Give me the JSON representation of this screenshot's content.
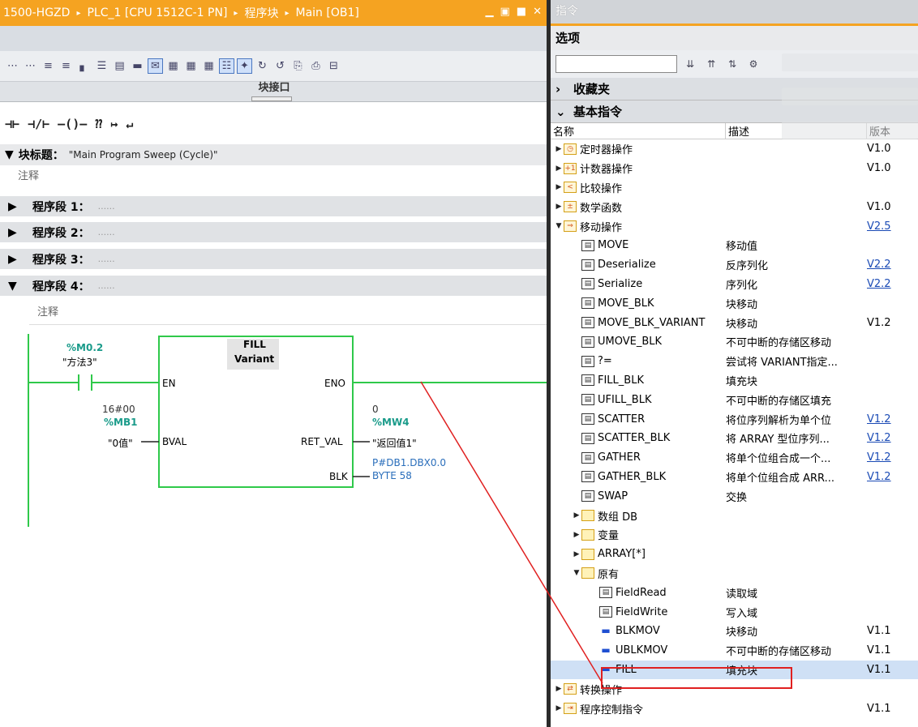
{
  "left": {
    "titlebar": {
      "crumbs": [
        "1500-HGZD",
        "PLC_1 [CPU 1512C-1 PN]",
        "程序块",
        "Main [OB1]"
      ],
      "sep": "▸"
    },
    "interface_bar": "块接口",
    "ladder_buttons": [
      "⊣⊢",
      "⊣/⊢",
      "–()–",
      "⁇",
      "↦",
      "↵"
    ],
    "block_title_label": "块标题：",
    "block_title_value": "\"Main Program Sweep (Cycle)\"",
    "comment": "注释",
    "networks": [
      {
        "label": "程序段 1：",
        "dots": "......",
        "expanded": false
      },
      {
        "label": "程序段 2：",
        "dots": "......",
        "expanded": false
      },
      {
        "label": "程序段 3：",
        "dots": "......",
        "expanded": false
      },
      {
        "label": "程序段 4：",
        "dots": "......",
        "expanded": true
      }
    ],
    "network4_comment": "注释",
    "contact": {
      "address": "%M0.2",
      "name": "\"方法3\""
    },
    "fill_block": {
      "title": "FILL",
      "type": "Variant",
      "pin_en": "EN",
      "pin_eno": "ENO",
      "pin_bval": "BVAL",
      "pin_retval": "RET_VAL",
      "pin_blk": "BLK",
      "bval_value": "16#00",
      "bval_address": "%MB1",
      "bval_name": "\"0值\"",
      "retval_value": "0",
      "retval_address": "%MW4",
      "retval_name": "\"返回值1\"",
      "blk_line1": "P#DB1.DBX0.0",
      "blk_line2": "BYTE 58"
    }
  },
  "right": {
    "title": "指令",
    "options": "选项",
    "favorites": "收藏夹",
    "basic": "基本指令",
    "columns": [
      "名称",
      "描述",
      "版本"
    ],
    "rows": [
      {
        "indent": 0,
        "exp": "▶",
        "icon": "timer-icon",
        "glyph": "◷",
        "name": "定时器操作",
        "desc": "",
        "ver": "V1.0",
        "link": false,
        "hl": false
      },
      {
        "indent": 0,
        "exp": "▶",
        "icon": "counter-icon",
        "glyph": "+1",
        "name": "计数器操作",
        "desc": "",
        "ver": "V1.0",
        "link": false,
        "hl": false
      },
      {
        "indent": 0,
        "exp": "▶",
        "icon": "compare-icon",
        "glyph": "<",
        "name": "比较操作",
        "desc": "",
        "ver": "",
        "link": false,
        "hl": false
      },
      {
        "indent": 0,
        "exp": "▶",
        "icon": "math-icon",
        "glyph": "±",
        "name": "数学函数",
        "desc": "",
        "ver": "V1.0",
        "link": false,
        "hl": false
      },
      {
        "indent": 0,
        "exp": "▼",
        "icon": "move-icon",
        "glyph": "⇒",
        "name": "移动操作",
        "desc": "",
        "ver": "V2.5",
        "link": true,
        "hl": false
      },
      {
        "indent": 1,
        "exp": "",
        "icon": "instruction-icon",
        "glyph": "▤",
        "name": "MOVE",
        "desc": "移动值",
        "ver": "",
        "link": false,
        "hl": false
      },
      {
        "indent": 1,
        "exp": "",
        "icon": "instruction-icon",
        "glyph": "▤",
        "name": "Deserialize",
        "desc": "反序列化",
        "ver": "V2.2",
        "link": true,
        "hl": false
      },
      {
        "indent": 1,
        "exp": "",
        "icon": "instruction-icon",
        "glyph": "▤",
        "name": "Serialize",
        "desc": "序列化",
        "ver": "V2.2",
        "link": true,
        "hl": false
      },
      {
        "indent": 1,
        "exp": "",
        "icon": "instruction-icon",
        "glyph": "▤",
        "name": "MOVE_BLK",
        "desc": "块移动",
        "ver": "",
        "link": false,
        "hl": false
      },
      {
        "indent": 1,
        "exp": "",
        "icon": "instruction-icon",
        "glyph": "▤",
        "name": "MOVE_BLK_VARIANT",
        "desc": "块移动",
        "ver": "V1.2",
        "link": false,
        "hl": false
      },
      {
        "indent": 1,
        "exp": "",
        "icon": "instruction-icon",
        "glyph": "▤",
        "name": "UMOVE_BLK",
        "desc": "不可中断的存储区移动",
        "ver": "",
        "link": false,
        "hl": false
      },
      {
        "indent": 1,
        "exp": "",
        "icon": "instruction-icon",
        "glyph": "▤",
        "name": "?=",
        "desc": "尝试将 VARIANT指定...",
        "ver": "",
        "link": false,
        "hl": false
      },
      {
        "indent": 1,
        "exp": "",
        "icon": "instruction-icon",
        "glyph": "▤",
        "name": "FILL_BLK",
        "desc": "填充块",
        "ver": "",
        "link": false,
        "hl": false
      },
      {
        "indent": 1,
        "exp": "",
        "icon": "instruction-icon",
        "glyph": "▤",
        "name": "UFILL_BLK",
        "desc": "不可中断的存储区填充",
        "ver": "",
        "link": false,
        "hl": false
      },
      {
        "indent": 1,
        "exp": "",
        "icon": "instruction-icon",
        "glyph": "▤",
        "name": "SCATTER",
        "desc": "将位序列解析为单个位",
        "ver": "V1.2",
        "link": true,
        "hl": false
      },
      {
        "indent": 1,
        "exp": "",
        "icon": "instruction-icon",
        "glyph": "▤",
        "name": "SCATTER_BLK",
        "desc": "将 ARRAY 型位序列...",
        "ver": "V1.2",
        "link": true,
        "hl": false
      },
      {
        "indent": 1,
        "exp": "",
        "icon": "instruction-icon",
        "glyph": "▤",
        "name": "GATHER",
        "desc": "将单个位组合成一个...",
        "ver": "V1.2",
        "link": true,
        "hl": false
      },
      {
        "indent": 1,
        "exp": "",
        "icon": "instruction-icon",
        "glyph": "▤",
        "name": "GATHER_BLK",
        "desc": "将单个位组合成 ARR...",
        "ver": "V1.2",
        "link": true,
        "hl": false
      },
      {
        "indent": 1,
        "exp": "",
        "icon": "instruction-icon",
        "glyph": "▤",
        "name": "SWAP",
        "desc": "交换",
        "ver": "",
        "link": false,
        "hl": false
      },
      {
        "indent": 1,
        "exp": "▶",
        "icon": "folder-icon",
        "glyph": "",
        "name": "数组 DB",
        "desc": "",
        "ver": "",
        "link": false,
        "hl": false
      },
      {
        "indent": 1,
        "exp": "▶",
        "icon": "folder-icon",
        "glyph": "",
        "name": "变量",
        "desc": "",
        "ver": "",
        "link": false,
        "hl": false
      },
      {
        "indent": 1,
        "exp": "▶",
        "icon": "folder-icon",
        "glyph": "",
        "name": "ARRAY[*]",
        "desc": "",
        "ver": "",
        "link": false,
        "hl": false
      },
      {
        "indent": 1,
        "exp": "▼",
        "icon": "folder-icon",
        "glyph": "",
        "name": "原有",
        "desc": "",
        "ver": "",
        "link": false,
        "hl": false
      },
      {
        "indent": 2,
        "exp": "",
        "icon": "instruction-icon",
        "glyph": "▤",
        "name": "FieldRead",
        "desc": "读取域",
        "ver": "",
        "link": false,
        "hl": false
      },
      {
        "indent": 2,
        "exp": "",
        "icon": "instruction-icon",
        "glyph": "▤",
        "name": "FieldWrite",
        "desc": "写入域",
        "ver": "",
        "link": false,
        "hl": false
      },
      {
        "indent": 2,
        "exp": "",
        "icon": "system-block-icon",
        "glyph": "▬",
        "name": "BLKMOV",
        "desc": "块移动",
        "ver": "V1.1",
        "link": false,
        "hl": false
      },
      {
        "indent": 2,
        "exp": "",
        "icon": "system-block-icon",
        "glyph": "▬",
        "name": "UBLKMOV",
        "desc": "不可中断的存储区移动",
        "ver": "V1.1",
        "link": false,
        "hl": false
      },
      {
        "indent": 2,
        "exp": "",
        "icon": "system-block-icon",
        "glyph": "▬",
        "name": "FILL",
        "desc": "填充块",
        "ver": "V1.1",
        "link": false,
        "hl": true
      },
      {
        "indent": 0,
        "exp": "▶",
        "icon": "convert-icon",
        "glyph": "⇄",
        "name": "转换操作",
        "desc": "",
        "ver": "",
        "link": false,
        "hl": false
      },
      {
        "indent": 0,
        "exp": "▶",
        "icon": "program-control-icon",
        "glyph": "⇥",
        "name": "程序控制指令",
        "desc": "",
        "ver": "V1.1",
        "link": false,
        "hl": false
      }
    ]
  }
}
